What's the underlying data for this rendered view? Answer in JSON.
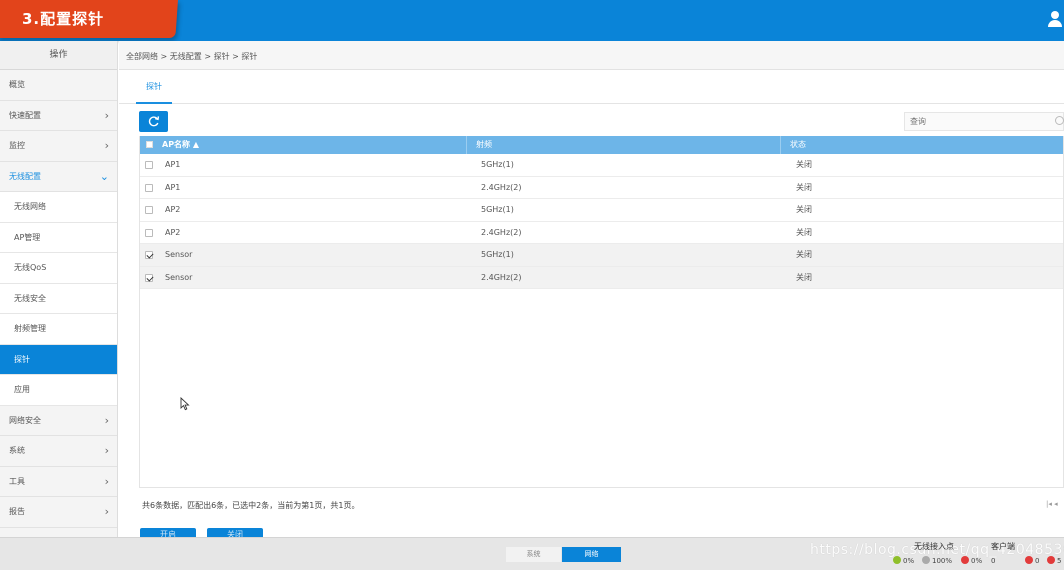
{
  "banner": {
    "title": "3.配置探针"
  },
  "sidebar": {
    "header": "操作",
    "items": [
      {
        "label": "概览"
      },
      {
        "label": "快速配置",
        "chevron": "›"
      },
      {
        "label": "监控",
        "chevron": "›"
      },
      {
        "label": "无线配置",
        "chevron": "⌄"
      },
      {
        "label": "网络安全",
        "chevron": "›"
      },
      {
        "label": "系统",
        "chevron": "›"
      },
      {
        "label": "工具",
        "chevron": "›"
      },
      {
        "label": "报告",
        "chevron": "›"
      }
    ],
    "subitems": [
      {
        "label": "无线网络"
      },
      {
        "label": "AP管理"
      },
      {
        "label": "无线QoS"
      },
      {
        "label": "无线安全"
      },
      {
        "label": "射频管理"
      },
      {
        "label": "探针"
      },
      {
        "label": "应用"
      }
    ]
  },
  "breadcrumb": "全部网络 > 无线配置 > 探针 > 探针",
  "tabs": [
    {
      "label": "探针"
    }
  ],
  "search": {
    "placeholder": "查询",
    "value": ""
  },
  "table": {
    "columns": [
      "AP名称 ▲",
      "射频",
      "状态"
    ],
    "rows": [
      {
        "name": "AP1",
        "radio": "5GHz(1)",
        "status": "关闭",
        "checked": false
      },
      {
        "name": "AP1",
        "radio": "2.4GHz(2)",
        "status": "关闭",
        "checked": false
      },
      {
        "name": "AP2",
        "radio": "5GHz(1)",
        "status": "关闭",
        "checked": false
      },
      {
        "name": "AP2",
        "radio": "2.4GHz(2)",
        "status": "关闭",
        "checked": false
      },
      {
        "name": "Sensor",
        "radio": "5GHz(1)",
        "status": "关闭",
        "checked": true
      },
      {
        "name": "Sensor",
        "radio": "2.4GHz(2)",
        "status": "关闭",
        "checked": true
      }
    ]
  },
  "summary": "共6条数据，匹配出6条，已选中2条，当前为第1页，共1页。",
  "pager": "|◂ ◂",
  "actions": {
    "open": "开启",
    "close": "关闭"
  },
  "footer": {
    "tab_system": "系统",
    "tab_network": "网络",
    "watermark": "https://blog.csdn.net/qq_42048536",
    "ap_title": "无线接入点",
    "ap_stats": {
      "green": "0%",
      "gray": "100%",
      "red": "0%"
    },
    "client_title": "客户端",
    "client_stats": {
      "value": "0",
      "red1": "0",
      "red2": "5"
    }
  },
  "colors": {
    "primary": "#0a84d8",
    "banner": "#e2441b",
    "table_header": "#6db5e8"
  }
}
